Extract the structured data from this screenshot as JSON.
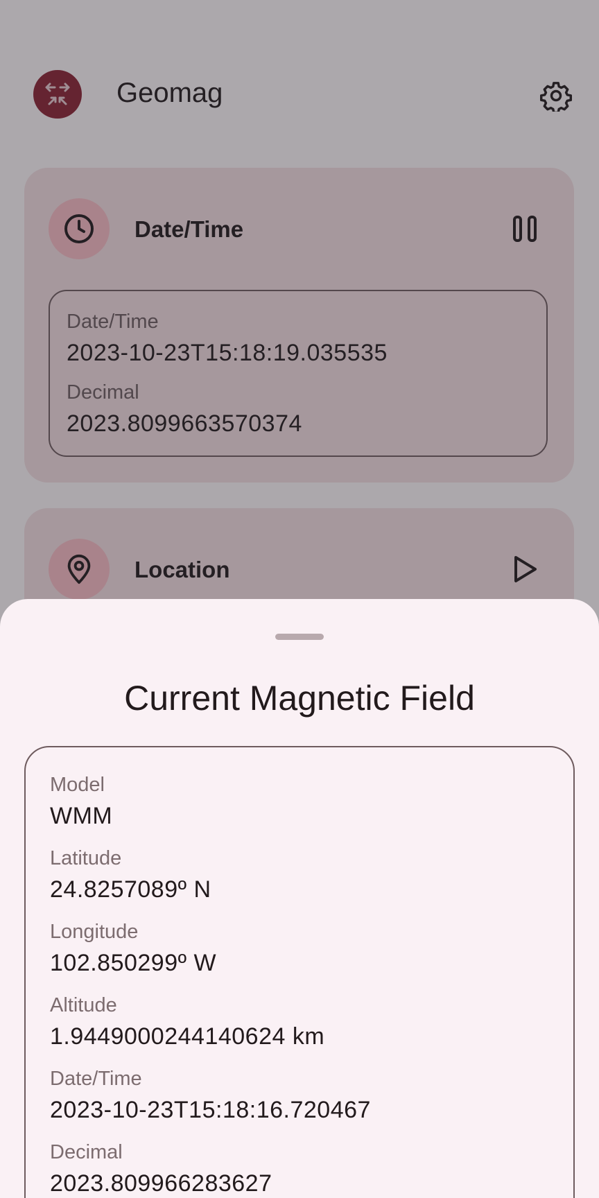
{
  "app": {
    "title": "Geomag",
    "logo_icon": "compass-arrows-icon",
    "settings_icon": "gear-icon"
  },
  "datetime_card": {
    "title": "Date/Time",
    "icon": "clock-icon",
    "action_icon": "pause-icon",
    "fields": [
      {
        "label": "Date/Time",
        "value": "2023-10-23T15:18:19.035535"
      },
      {
        "label": "Decimal",
        "value": "2023.8099663570374"
      }
    ]
  },
  "location_card": {
    "title": "Location",
    "icon": "location-pin-icon",
    "action_icon": "play-icon"
  },
  "sheet": {
    "title": "Current Magnetic Field",
    "fields": [
      {
        "label": "Model",
        "value": "WMM"
      },
      {
        "label": "Latitude",
        "value": "24.8257089º N"
      },
      {
        "label": "Longitude",
        "value": "102.850299º W"
      },
      {
        "label": "Altitude",
        "value": "1.9449000244140624 km"
      },
      {
        "label": "Date/Time",
        "value": "2023-10-23T15:18:16.720467"
      },
      {
        "label": "Decimal",
        "value": "2023.809966283627"
      }
    ]
  },
  "colors": {
    "primary": "#8c2233",
    "card": "#f4dde0",
    "sheet": "#faf1f5"
  }
}
